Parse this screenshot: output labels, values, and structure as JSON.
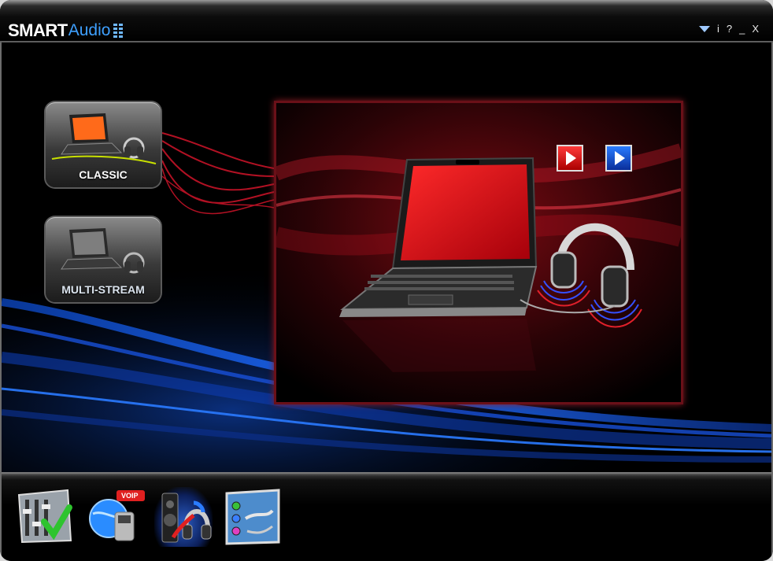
{
  "app": {
    "logo_smart": "SMART",
    "logo_audio": "Audio"
  },
  "window_controls": {
    "menu_icon": "triangle-down-icon",
    "info_label": "i",
    "help_label": "?",
    "minimize_label": "_",
    "close_label": "X"
  },
  "modes": [
    {
      "label": "CLASSIC",
      "icon": "laptop-headphones-icon",
      "selected": true
    },
    {
      "label": "MULTI-STREAM",
      "icon": "laptop-headphones-icon",
      "selected": false
    }
  ],
  "preview": {
    "red_play_icon": "play-icon",
    "blue_play_icon": "play-icon"
  },
  "toolbar": {
    "tools": [
      {
        "icon": "equalizer-check-icon"
      },
      {
        "icon": "voip-globe-icon",
        "badge": "VOIP"
      },
      {
        "icon": "speaker-headphones-icon",
        "active": true
      },
      {
        "icon": "audio-jacks-icon"
      }
    ]
  },
  "colors": {
    "accent_blue": "#3ea0ff",
    "accent_red": "#c4151f",
    "background": "#000000"
  }
}
